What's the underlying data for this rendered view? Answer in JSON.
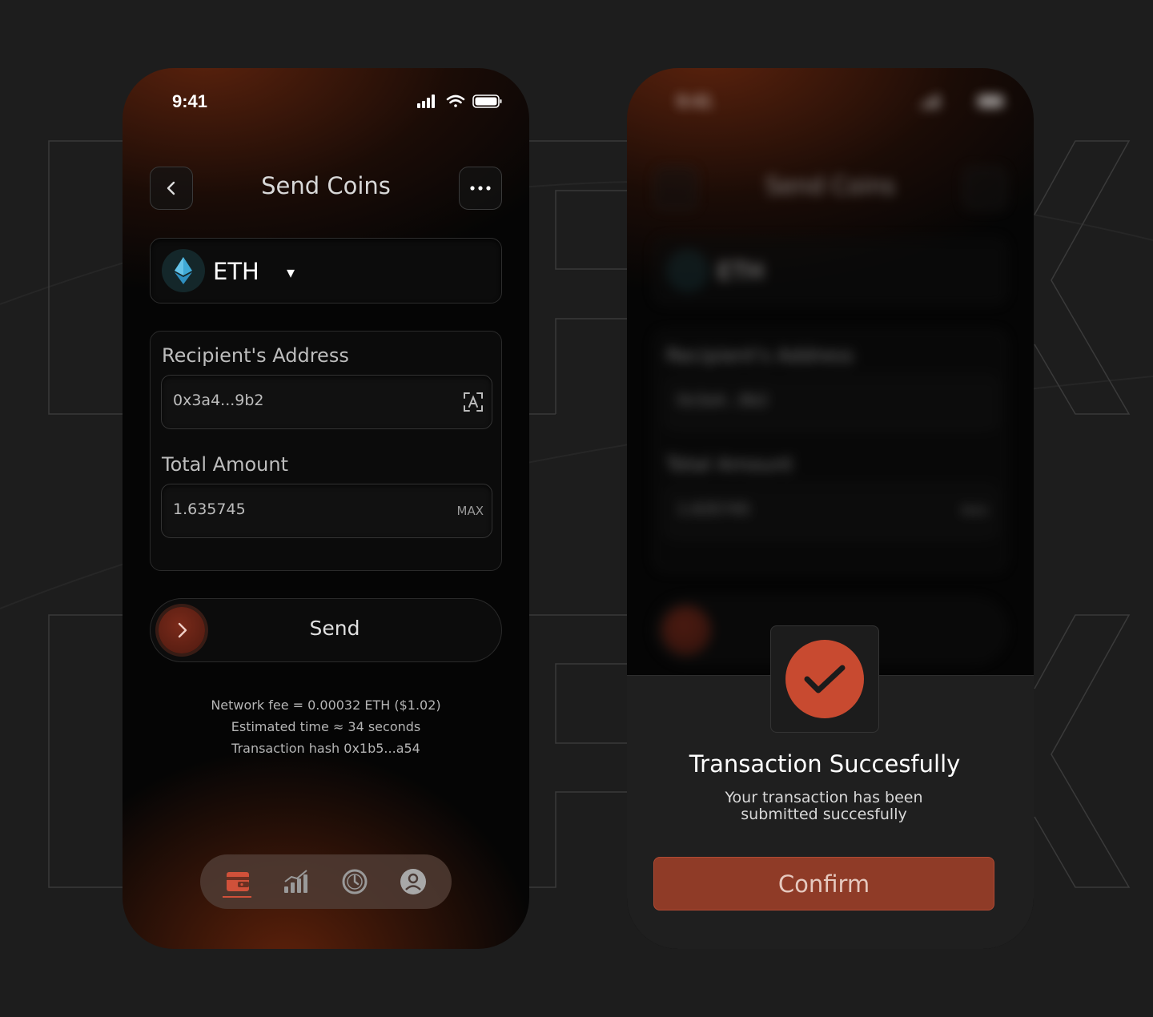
{
  "colors": {
    "accent": "#c84a30",
    "confirm": "#8f3b27",
    "background": "#1d1d1d",
    "eth": "#3fa9d6"
  },
  "status_bar": {
    "time": "9:41"
  },
  "send_screen": {
    "title": "Send Coins",
    "token": {
      "symbol": "ETH",
      "caret": "▾"
    },
    "recipient": {
      "label": "Recipient's Address",
      "value": "0x3a4...9b2"
    },
    "amount": {
      "label": "Total Amount",
      "value": "1.635745",
      "max_label": "MAX"
    },
    "send_label": "Send",
    "info": {
      "fee": "Network fee = 0.00032 ETH ($1.02)",
      "time": "Estimated time ≈ 34 seconds",
      "hash": "Transaction hash 0x1b5...a54"
    },
    "nav": [
      "wallet-icon",
      "chart-icon",
      "history-icon",
      "profile-icon"
    ]
  },
  "success_sheet": {
    "title": "Transaction Succesfully",
    "message_line1": "Your transaction has been",
    "message_line2": "submitted succesfully",
    "confirm_label": "Confirm"
  }
}
